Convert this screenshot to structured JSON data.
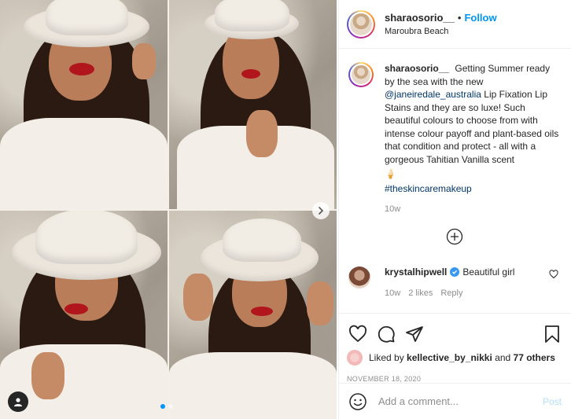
{
  "post": {
    "username": "sharaosorio__",
    "separator": "•",
    "follow_label": "Follow",
    "location": "Maroubra Beach",
    "caption": {
      "username": "sharaosorio__",
      "text_before": "Getting Summer ready by the sea with the new",
      "mention": "@janeiredale_australia",
      "text_after": "Lip Fixation Lip Stains and they are so luxe! Such beautiful colours to choose from with intense colour payoff and plant-based oils that condition and protect - all with a gorgeous Tahitian Vanilla scent",
      "emoji": "🍦",
      "hashtag": "#theskincaremakeup",
      "time": "10w"
    },
    "comments": [
      {
        "username": "krystalhipwell",
        "verified": true,
        "text": "Beautiful girl",
        "time": "10w",
        "likes": "2 likes",
        "reply_label": "Reply"
      }
    ],
    "liked_by": {
      "prefix": "Liked by",
      "user": "kellective_by_nikki",
      "and": "and",
      "others": "77 others"
    },
    "date": "NOVEMBER 18, 2020",
    "comment_placeholder": "Add a comment...",
    "post_label": "Post"
  },
  "carousel": {
    "total_slides": 2,
    "active_slide": 1
  },
  "colors": {
    "link_blue": "#0095f6",
    "mention_blue": "#00376b",
    "muted": "#8e8e8e",
    "post_disabled": "#b2dffc"
  },
  "icons": [
    "heart-icon",
    "comment-icon",
    "share-icon",
    "bookmark-icon",
    "emoji-icon",
    "plus-circle-icon",
    "chevron-right-icon",
    "user-tag-icon",
    "verified-icon"
  ]
}
